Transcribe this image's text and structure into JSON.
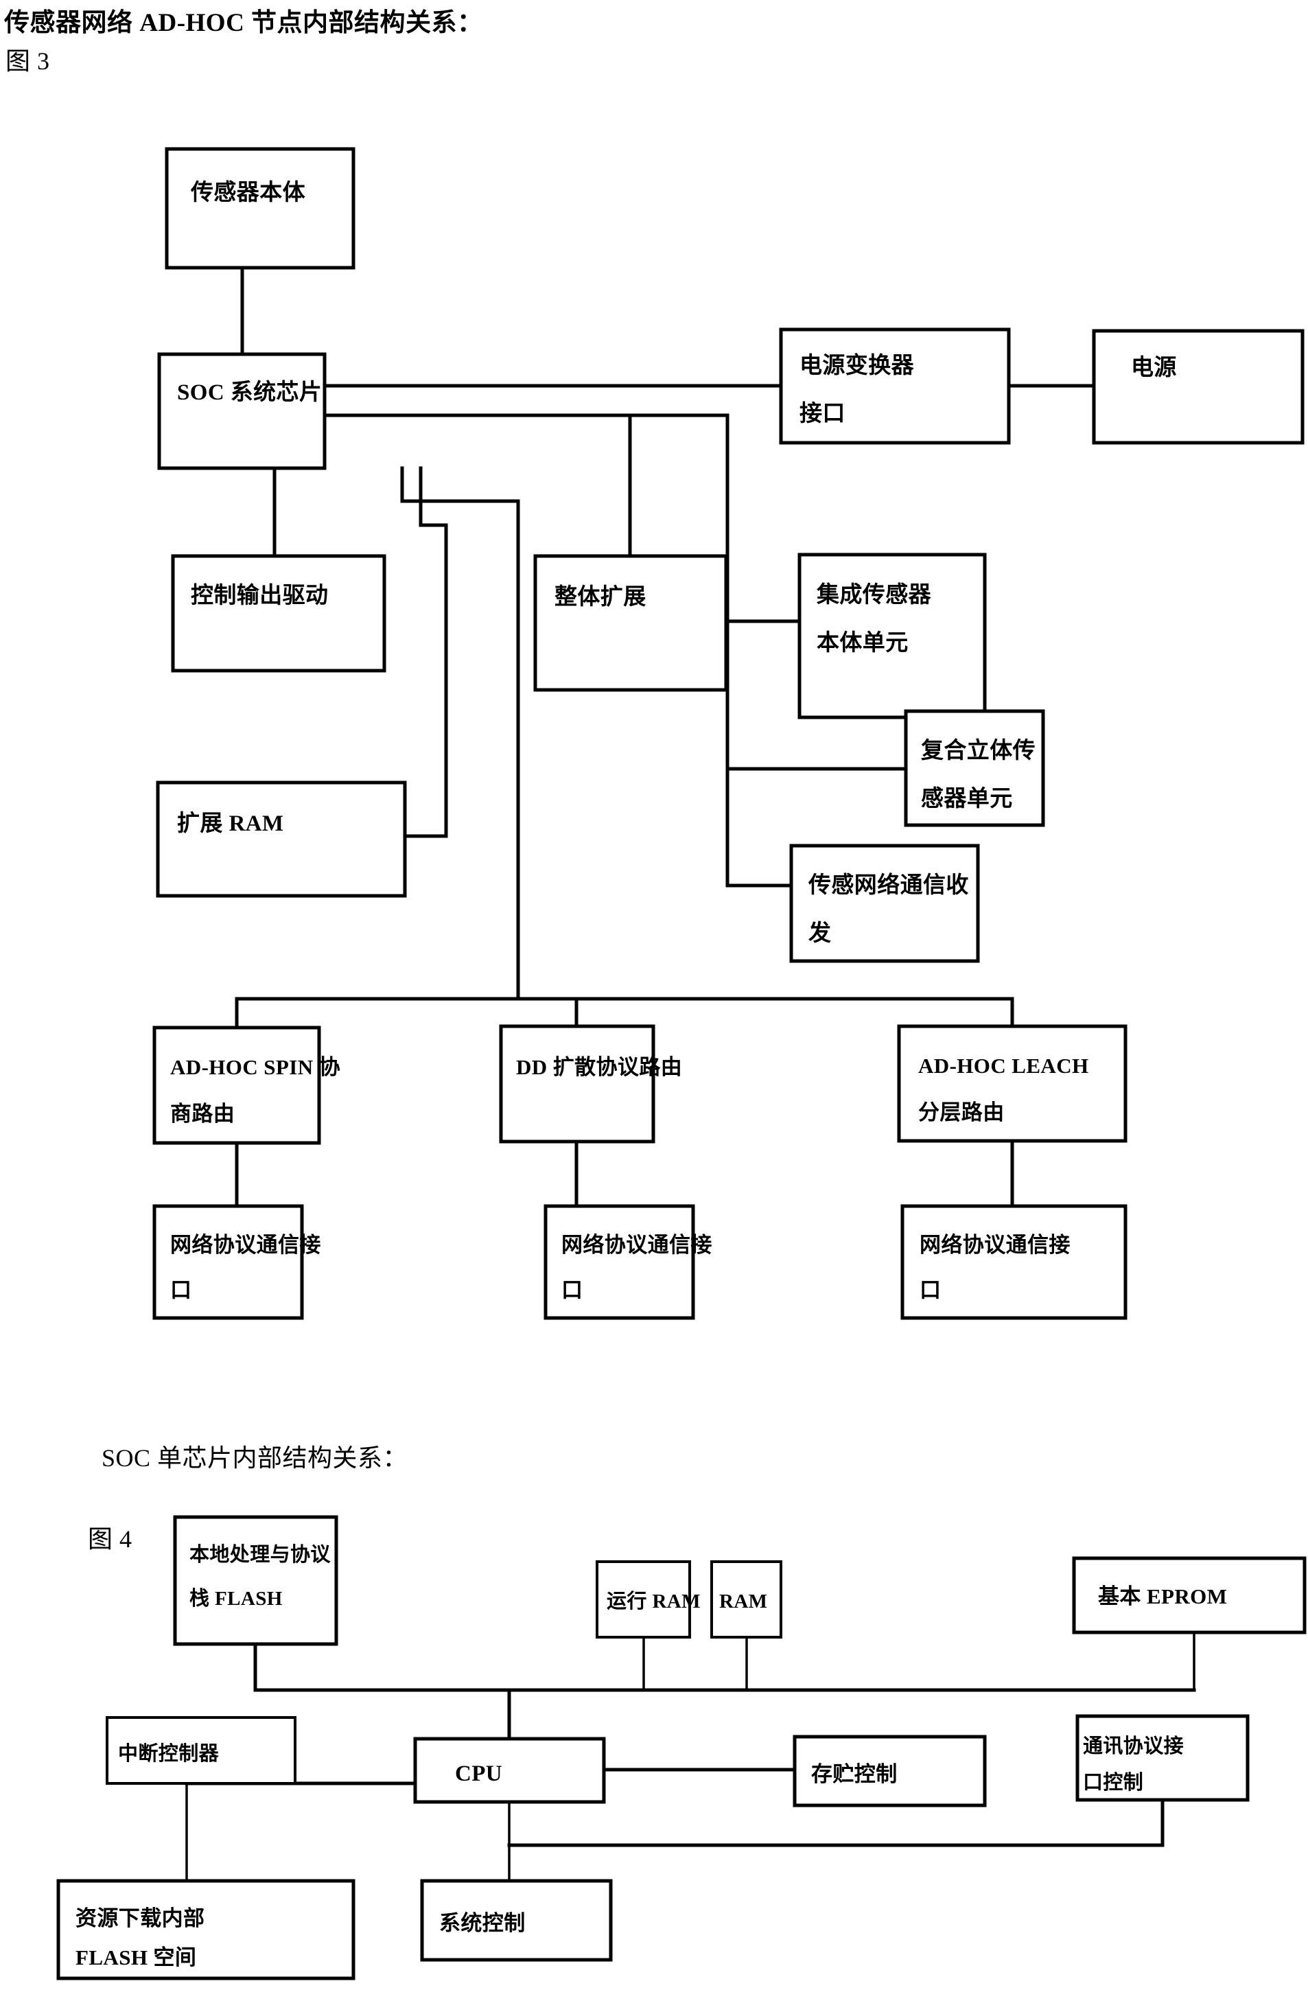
{
  "figure3": {
    "title": "传感器网络 AD-HOC 节点内部结构关系：",
    "label": "图 3",
    "boxes": {
      "sensor_body": "传感器本体",
      "soc_chip": "SOC 系统芯片",
      "power_converter_interface_l1": "电源变换器",
      "power_converter_interface_l2": "接口",
      "power_supply": "电源",
      "control_output_drive": "控制输出驱动",
      "overall_expansion": "整体扩展",
      "integrated_sensor_unit_l1": "集成传感器",
      "integrated_sensor_unit_l2": "本体单元",
      "composite_3d_sensor_unit_l1": "复合立体传",
      "composite_3d_sensor_unit_l2": "感器单元",
      "expansion_ram": "扩展 RAM",
      "sensor_network_comm_l1": "传感网络通信收",
      "sensor_network_comm_l2": "发",
      "spin_route_l1": "AD-HOC  SPIN 协",
      "spin_route_l2": "商路由",
      "dd_route": "DD 扩散协议路由",
      "leach_route_l1": "AD-HOC  LEACH",
      "leach_route_l2": "分层路由",
      "net_iface_1_l1": "网络协议通信接",
      "net_iface_1_l2": "口",
      "net_iface_2_l1": "网络协议通信接",
      "net_iface_2_l2": "口",
      "net_iface_3_l1": "网络协议通信接",
      "net_iface_3_l2": "口"
    }
  },
  "figure4": {
    "title": "SOC 单芯片内部结构关系：",
    "label": "图 4",
    "boxes": {
      "local_proc_flash_l1": "本地处理与协议",
      "local_proc_flash_l2": "栈 FLASH",
      "run_ram": "运行 RAM",
      "ram": "RAM",
      "basic_eprom": "基本 EPROM",
      "interrupt_controller": "中断控制器",
      "cpu": "CPU",
      "storage_control": "存贮控制",
      "comm_protocol_iface_l1": "通讯协议接",
      "comm_protocol_iface_l2": "口控制",
      "resource_download_flash_l1": "资源下载内部",
      "resource_download_flash_l2": "FLASH 空间",
      "system_control": "系统控制"
    }
  },
  "colors": {
    "ink": "#000000",
    "paper": "#ffffff"
  }
}
